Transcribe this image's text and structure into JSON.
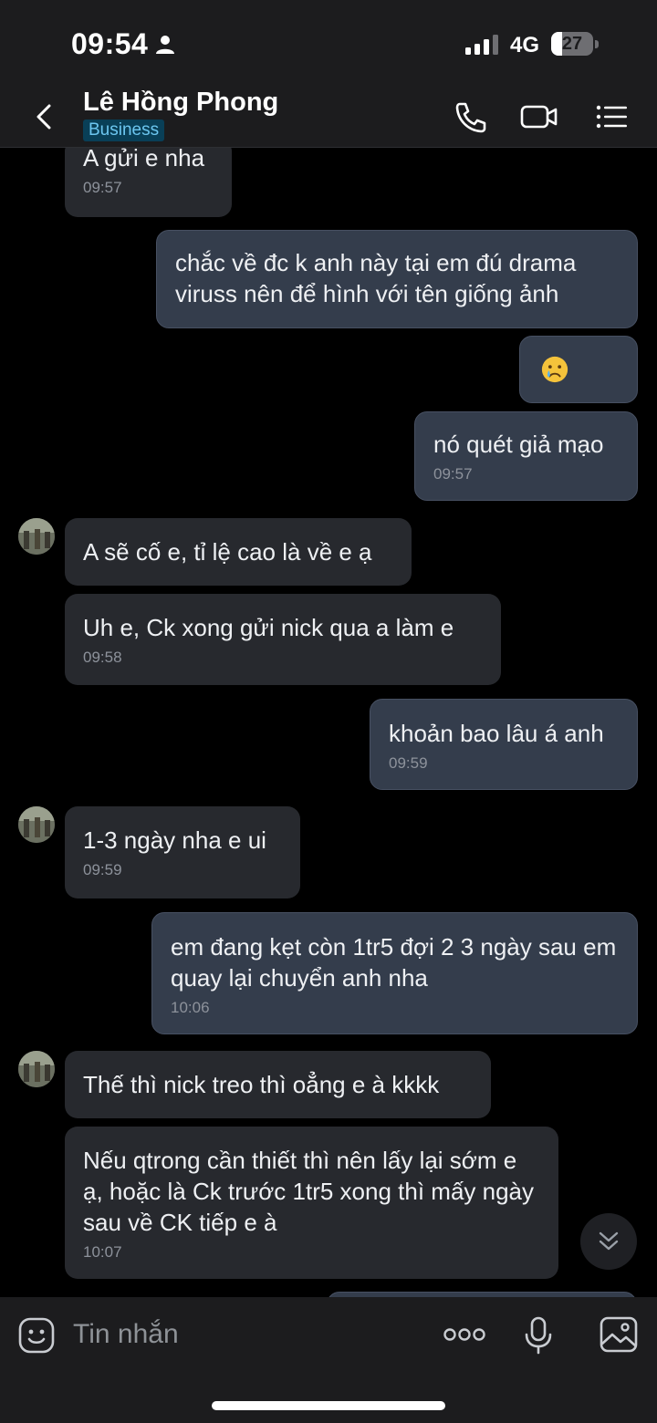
{
  "status_bar": {
    "time": "09:54",
    "network": "4G",
    "battery": "27",
    "battery_level": 0.27
  },
  "header": {
    "contact_name": "Lê Hồng Phong",
    "badge": "Business"
  },
  "messages": [
    {
      "direction": "in",
      "text": "A gửi e nha",
      "time": "09:57"
    },
    {
      "direction": "out",
      "text": "chắc về đc k anh này tại em đú drama viruss nên để hình với tên giống ảnh",
      "time": ""
    },
    {
      "direction": "out",
      "text": "😢",
      "time": ""
    },
    {
      "direction": "out",
      "text": "nó quét giả mạo",
      "time": "09:57"
    },
    {
      "direction": "in",
      "text": "A sẽ cố e, tỉ lệ cao là về e ạ",
      "time": ""
    },
    {
      "direction": "in",
      "text": "Uh e, Ck xong gửi nick qua a làm e",
      "time": "09:58"
    },
    {
      "direction": "out",
      "text": "khoản bao lâu á anh",
      "time": "09:59"
    },
    {
      "direction": "in",
      "text": "1-3 ngày nha e ui",
      "time": "09:59"
    },
    {
      "direction": "out",
      "text": "em đang kẹt còn 1tr5 đợi 2 3 ngày sau em quay lại chuyển anh nha",
      "time": "10:06"
    },
    {
      "direction": "in",
      "text": "Thế thì nick treo thì oẳng e à kkkk",
      "time": ""
    },
    {
      "direction": "in",
      "text": "Nếu qtrong cần thiết thì nên lấy lại sớm e ạ, hoặc là Ck trước 1tr5 xong thì mấy ngày sau về CK tiếp e à",
      "time": "10:07"
    }
  ],
  "composer": {
    "placeholder": "Tin nhắn"
  },
  "colors": {
    "incoming_bubble": "#27292e",
    "outgoing_bubble": "#343d4c",
    "badge_bg": "#093f57",
    "badge_text": "#6cc6f0"
  }
}
